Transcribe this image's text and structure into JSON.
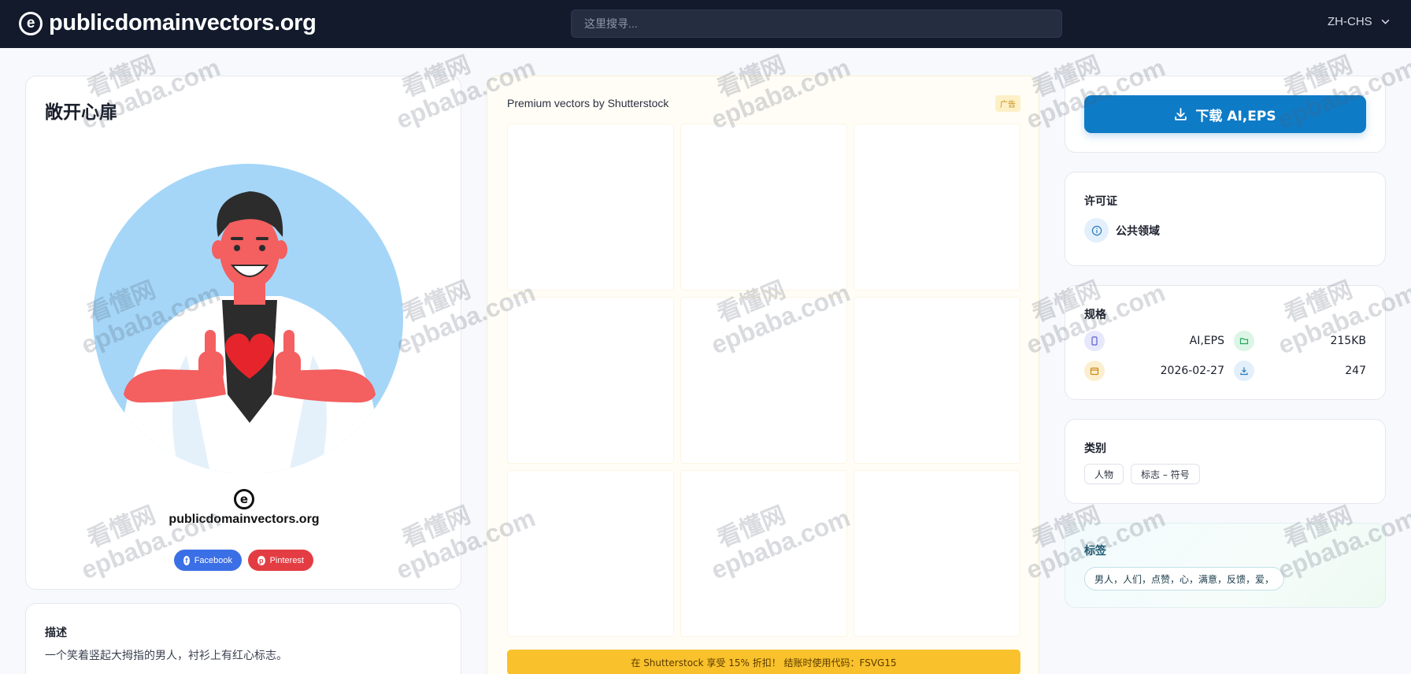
{
  "header": {
    "site_name": "publicdomainvectors.org",
    "logo_glyph": "e",
    "search_placeholder": "这里搜寻...",
    "language": "ZH-CHS"
  },
  "image": {
    "title": "敞开心扉",
    "watermark_site": "publicdomainvectors.org",
    "watermark_glyph": "e",
    "share": {
      "facebook_label": "Facebook",
      "pinterest_label": "Pinterest"
    }
  },
  "description": {
    "heading": "描述",
    "text": "一个笑着竖起大拇指的男人，衬衫上有红心标志。"
  },
  "ad": {
    "title": "Premium vectors by Shutterstock",
    "badge": "广告",
    "tile_count": 9,
    "promo": "在 Shutterstock 享受 15% 折扣！ 结账时使用代码：FSVG15"
  },
  "download": {
    "label": "下载 AI,EPS",
    "icon": "download-icon"
  },
  "license": {
    "heading": "许可证",
    "value": "公共领域",
    "icon": "info-icon"
  },
  "specs": {
    "heading": "规格",
    "format": "AI,EPS",
    "size": "215KB",
    "date": "2026-02-27",
    "downloads": "247"
  },
  "categories": {
    "heading": "类别",
    "items": [
      "人物",
      "标志 – 符号"
    ]
  },
  "tags": {
    "heading": "标签",
    "value": "男人，人们，点赞，心，满意，反馈，爱，"
  },
  "overlay_watermark": {
    "line1": "看懂网",
    "line2": "epbaba.com"
  },
  "colors": {
    "header_bg": "#121a2c",
    "accent": "#0e7bc7",
    "promo_bg": "#f9c12b",
    "facebook": "#3b6fe6",
    "pinterest": "#e33d43"
  }
}
